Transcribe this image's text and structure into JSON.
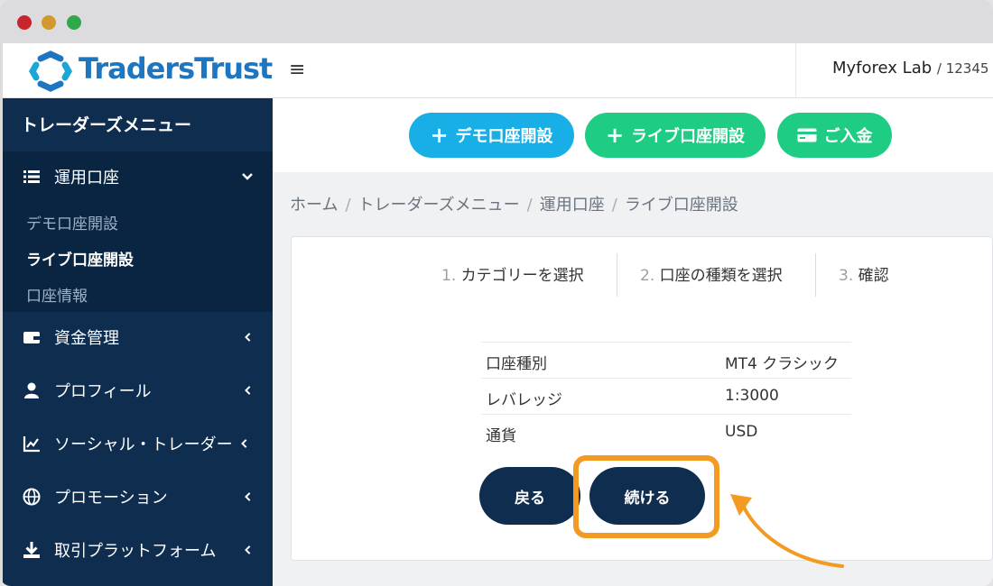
{
  "sidebar": {
    "logo_text": "TradersTrust",
    "menu_title": "トレーダーズメニュー",
    "open_section": {
      "label": "運用口座",
      "icon": "list-icon"
    },
    "sub_items": [
      {
        "label": "デモ口座開設"
      },
      {
        "label": "ライブ口座開設",
        "active": true
      },
      {
        "label": "口座情報"
      }
    ],
    "items": [
      {
        "label": "資金管理",
        "icon": "wallet-icon"
      },
      {
        "label": "プロフィール",
        "icon": "user-icon"
      },
      {
        "label": "ソーシャル・トレーダー",
        "icon": "chart-icon"
      },
      {
        "label": "プロモーション",
        "icon": "globe-icon"
      },
      {
        "label": "取引プラットフォーム",
        "icon": "download-icon"
      }
    ]
  },
  "header": {
    "menu_icon": "≡",
    "user_name": "Myforex Lab",
    "user_id": "/ 12345"
  },
  "actions": {
    "demo": "デモ口座開設",
    "live": "ライブ口座開設",
    "deposit": "ご入金"
  },
  "breadcrumb": [
    "ホーム",
    "トレーダーズメニュー",
    "運用口座",
    "ライブ口座開設"
  ],
  "steps": [
    {
      "num": "1.",
      "label": "カテゴリーを選択"
    },
    {
      "num": "2.",
      "label": "口座の種類を選択"
    },
    {
      "num": "3.",
      "label": "確認"
    }
  ],
  "summary": [
    {
      "key": "口座種別",
      "value": "MT4 クラシック"
    },
    {
      "key": "レバレッジ",
      "value": "1:3000"
    },
    {
      "key": "通貨",
      "value": "USD"
    }
  ],
  "buttons": {
    "back": "戻る",
    "continue": "続ける"
  },
  "colors": {
    "accent_orange": "#f29a22",
    "navy": "#0e2d4f",
    "blue": "#18aee6",
    "green": "#1fcc83"
  }
}
